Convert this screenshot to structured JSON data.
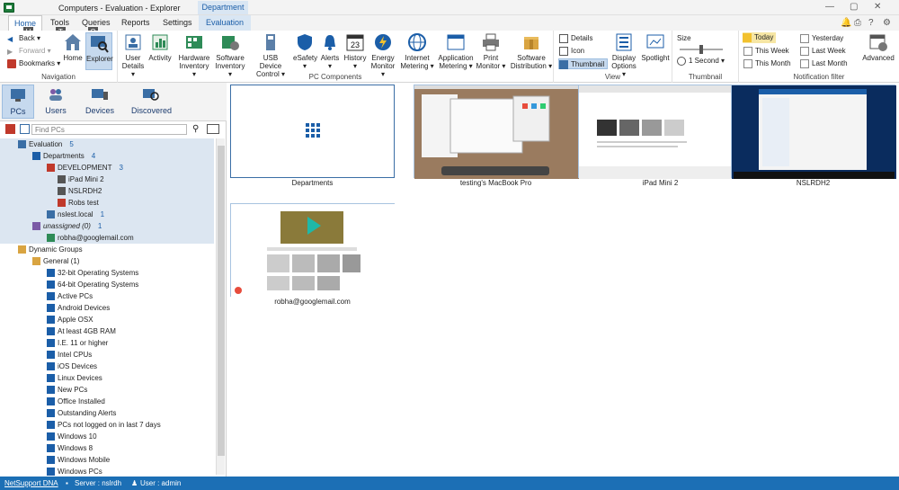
{
  "window": {
    "title": "Computers - Evaluation - Explorer",
    "context_header": "Department"
  },
  "tabs": [
    "Home",
    "Tools",
    "Queries",
    "Reports",
    "Settings",
    "Evaluation"
  ],
  "keytips": {
    "home": "H",
    "tools": "T",
    "explorer": "Q"
  },
  "navigation": {
    "back": "Back",
    "forward": "Forward",
    "bookmarks": "Bookmarks",
    "home": "Home",
    "explorer": "Explorer",
    "label": "Navigation"
  },
  "pc_components": {
    "label": "PC Components",
    "items": [
      "User\nDetails",
      "Activity",
      "Hardware\nInventory",
      "Software\nInventory",
      "USB Device\nControl",
      "eSafety",
      "Alerts",
      "History",
      "Energy\nMonitor",
      "Internet\nMetering",
      "Application\nMetering",
      "Print\nMonitor",
      "Software\nDistribution"
    ],
    "history_day": "23"
  },
  "view": {
    "label": "View",
    "details": "Details",
    "icon": "Icon",
    "thumbnail": "Thumbnail",
    "display_options": "Display\nOptions",
    "spotlight": "Spotlight"
  },
  "thumbnail_group": {
    "label": "Thumbnail",
    "size": "Size",
    "interval": "1 Second"
  },
  "notification": {
    "label": "Notification filter",
    "items": [
      "Today",
      "This Week",
      "This Month",
      "Yesterday",
      "Last Week",
      "Last Month"
    ],
    "advanced": "Advanced"
  },
  "navrow": {
    "pcs": "PCs",
    "users": "Users",
    "devices": "Devices",
    "discovered": "Discovered"
  },
  "find_placeholder": "Find PCs",
  "tree": [
    {
      "label": "Evaluation",
      "count": "5",
      "level": 1
    },
    {
      "label": "Departments",
      "count": "4",
      "level": 2
    },
    {
      "label": "DEVELOPMENT",
      "count": "3",
      "level": 3
    },
    {
      "label": "iPad Mini 2",
      "count": "",
      "level": 4
    },
    {
      "label": "NSLRDH2",
      "count": "",
      "level": 4
    },
    {
      "label": "Robs test",
      "count": "",
      "level": 4
    },
    {
      "label": "nslest.local",
      "count": "1",
      "level": 3
    },
    {
      "label": "unassigned (0)",
      "count": "1",
      "level": 2
    },
    {
      "label": "robha@googlemail.com",
      "count": "",
      "level": 3
    },
    {
      "label": "Dynamic Groups",
      "count": "",
      "level": 1
    },
    {
      "label": "General (1)",
      "count": "",
      "level": 2
    },
    {
      "label": "32-bit Operating Systems",
      "count": "",
      "level": 3
    },
    {
      "label": "64-bit Operating Systems",
      "count": "",
      "level": 3
    },
    {
      "label": "Active PCs",
      "count": "",
      "level": 3
    },
    {
      "label": "Android Devices",
      "count": "",
      "level": 3
    },
    {
      "label": "Apple OSX",
      "count": "",
      "level": 3
    },
    {
      "label": "At least 4GB RAM",
      "count": "",
      "level": 3
    },
    {
      "label": "I.E. 11 or higher",
      "count": "",
      "level": 3
    },
    {
      "label": "Intel CPUs",
      "count": "",
      "level": 3
    },
    {
      "label": "iOS Devices",
      "count": "",
      "level": 3
    },
    {
      "label": "Linux Devices",
      "count": "",
      "level": 3
    },
    {
      "label": "New PCs",
      "count": "",
      "level": 3
    },
    {
      "label": "Office Installed",
      "count": "",
      "level": 3
    },
    {
      "label": "Outstanding Alerts",
      "count": "",
      "level": 3
    },
    {
      "label": "PCs not logged on in last 7 days",
      "count": "",
      "level": 3
    },
    {
      "label": "Windows 10",
      "count": "",
      "level": 3
    },
    {
      "label": "Windows 8",
      "count": "",
      "level": 3
    },
    {
      "label": "Windows Mobile",
      "count": "",
      "level": 3
    },
    {
      "label": "Windows PCs",
      "count": "",
      "level": 3
    }
  ],
  "thumbnails": [
    "Departments",
    "testing's MacBook Pro",
    "iPad Mini 2",
    "NSLRDH2",
    "robha@googlemail.com"
  ],
  "status": {
    "product": "NetSupport DNA",
    "server": "Server : nslrdh",
    "user": "User : admin"
  },
  "colors": {
    "accent": "#1c6fb5",
    "selection": "#dce6f1",
    "ribbon_active": "#c6d9ee"
  }
}
